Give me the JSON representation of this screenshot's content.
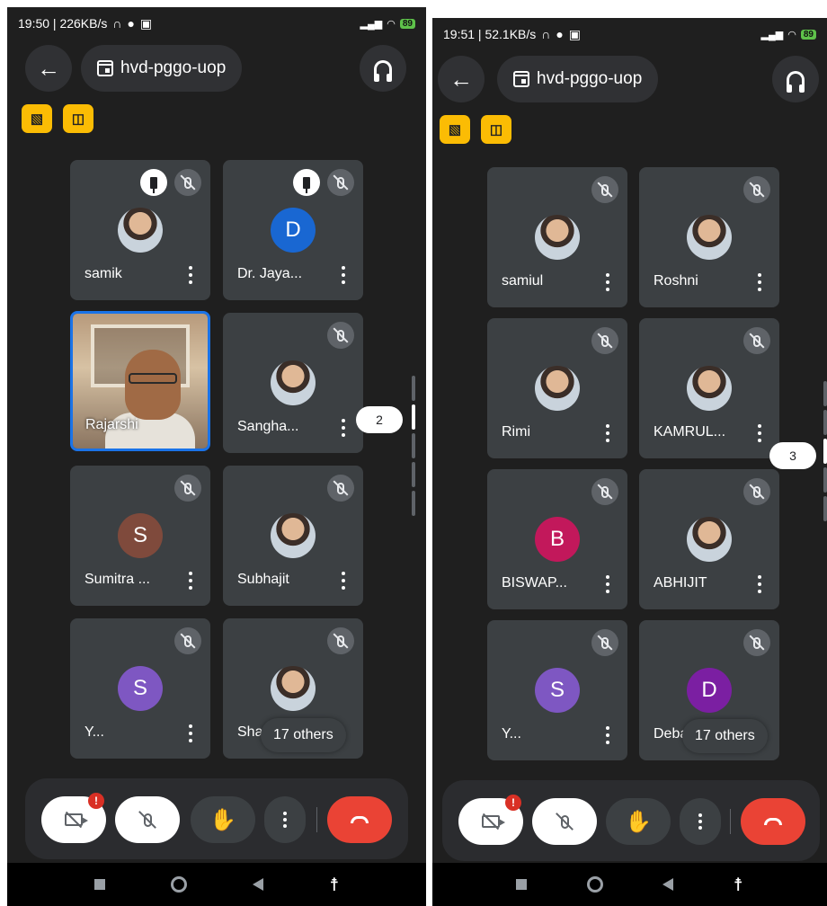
{
  "left": {
    "status": {
      "text": "19:50 | 226KB/s",
      "battery": "89"
    },
    "meeting_code": "hvd-pggo-uop",
    "tiles": [
      {
        "name": "samik",
        "avatar": "photo",
        "pinned": true
      },
      {
        "name": "Dr. Jaya...",
        "avatar": "letter",
        "initial": "D",
        "color": "#1967d2",
        "pinned": true
      },
      {
        "name": "Rajarshi",
        "avatar": "video",
        "active": true
      },
      {
        "name": "Sangha...",
        "avatar": "photo"
      },
      {
        "name": "Sumitra ...",
        "avatar": "letter",
        "initial": "S",
        "color": "#7f4a3c"
      },
      {
        "name": "Subhajit",
        "avatar": "photo"
      },
      {
        "name": "Y...",
        "avatar": "letter",
        "initial": "S",
        "color": "#7e57c2"
      },
      {
        "name": "Shar",
        "avatar": "photo"
      }
    ],
    "others_label": "17 others",
    "page_indicator": "2",
    "alert_badge": "!"
  },
  "right": {
    "status": {
      "text": "19:51 | 52.1KB/s",
      "battery": "89"
    },
    "meeting_code": "hvd-pggo-uop",
    "tiles": [
      {
        "name": "samiul",
        "avatar": "photo"
      },
      {
        "name": "Roshni",
        "avatar": "photo"
      },
      {
        "name": "Rimi",
        "avatar": "photo"
      },
      {
        "name": "KAMRUL...",
        "avatar": "photo"
      },
      {
        "name": "BISWAP...",
        "avatar": "letter",
        "initial": "B",
        "color": "#c2185b"
      },
      {
        "name": "ABHIJIT",
        "avatar": "photo"
      },
      {
        "name": "Y...",
        "avatar": "letter",
        "initial": "S",
        "color": "#7e57c2"
      },
      {
        "name": "Deba",
        "avatar": "letter",
        "initial": "D",
        "color": "#7b1fa2"
      }
    ],
    "others_label": "17 others",
    "page_indicator": "3",
    "alert_badge": "!"
  },
  "icons": {
    "back": "←",
    "hand": "✋",
    "accessibility": "🯅"
  },
  "colors": {
    "background": "#1f1f1f",
    "tile": "#3c4043",
    "end_call": "#ea4335",
    "badge": "#fbbc04",
    "active_border": "#1a73e8"
  }
}
